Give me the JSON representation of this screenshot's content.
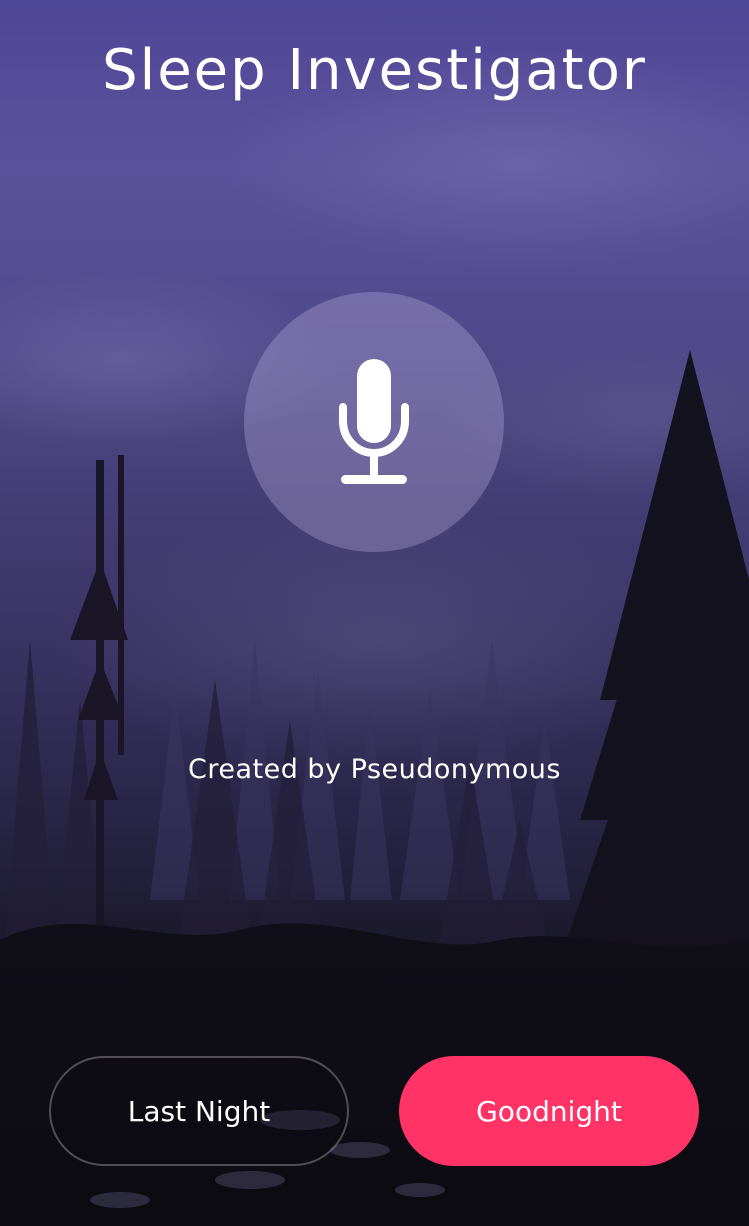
{
  "app": {
    "title": "Sleep Investigator"
  },
  "record": {
    "icon": "microphone-icon"
  },
  "footer": {
    "credit": "Created by Pseudonymous"
  },
  "actions": {
    "last_night_label": "Last Night",
    "goodnight_label": "Goodnight"
  },
  "colors": {
    "accent": "#ff3366",
    "sky_top": "#4f4797",
    "ground": "#0e0c14"
  }
}
